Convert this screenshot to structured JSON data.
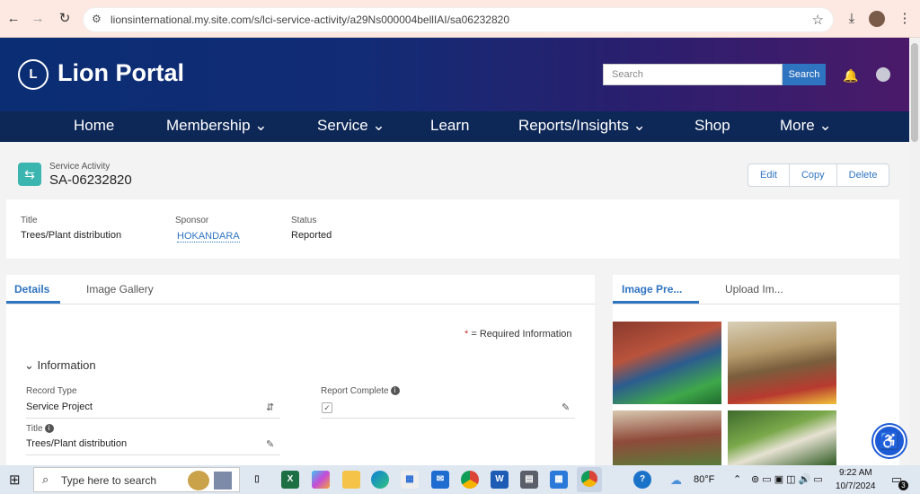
{
  "browser": {
    "url": "lionsinternational.my.site.com/s/lci-service-activity/a29Ns000004bellIAI/sa06232820",
    "icons": [
      "back-icon",
      "forward-icon",
      "reload-icon",
      "site-settings-icon",
      "star-icon",
      "download-icon",
      "profile-icon",
      "menu-icon"
    ]
  },
  "header": {
    "brand": "Lion Portal",
    "logo_text": "L",
    "search_placeholder": "Search",
    "search_button": "Search"
  },
  "nav": {
    "items": [
      {
        "label": "Home"
      },
      {
        "label": "Membership ⌄"
      },
      {
        "label": "Service ⌄"
      },
      {
        "label": "Learn"
      },
      {
        "label": "Reports/Insights ⌄"
      },
      {
        "label": "Shop"
      },
      {
        "label": "More ⌄"
      }
    ]
  },
  "record": {
    "type": "Service Activity",
    "name": "SA-06232820",
    "actions": [
      "Edit",
      "Copy",
      "Delete"
    ]
  },
  "highlights": {
    "title_label": "Title",
    "title_value": "Trees/Plant distribution",
    "sponsor_label": "Sponsor",
    "sponsor_value": "HOKANDARA",
    "status_label": "Status",
    "status_value": "Reported"
  },
  "details": {
    "tabs": [
      "Details",
      "Image Gallery"
    ],
    "required_star": "*",
    "required_text": " = Required Information",
    "section_title": "Information",
    "record_type_label": "Record Type",
    "record_type_value": "Service Project",
    "report_complete_label": "Report Complete",
    "report_complete_checked": true,
    "title_label": "Title",
    "title_value": "Trees/Plant distribution"
  },
  "images": {
    "tabs": [
      "Image Pre...",
      "Upload Im..."
    ]
  },
  "taskbar": {
    "search_placeholder": "Type here to search",
    "weather": "80°F",
    "time": "9:22 AM",
    "date": "10/7/2024",
    "notifications": "3"
  },
  "colors": {
    "brand_blue": "#0d2757",
    "accent": "#2f74c0",
    "teal_icon": "#3bb5b0"
  }
}
